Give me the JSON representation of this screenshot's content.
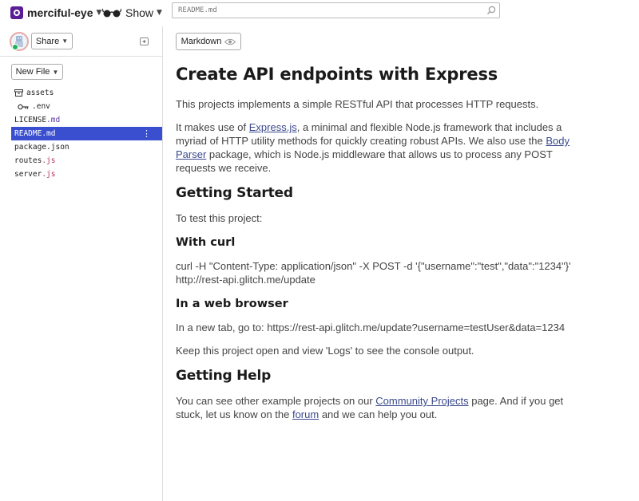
{
  "topbar": {
    "project_name": "merciful-eye",
    "show_label": "Show",
    "search_placeholder": "README.md",
    "icons": [
      "project-logo-icon",
      "chevron-down-icon",
      "glasses-icon",
      "search-icon"
    ]
  },
  "sidebar": {
    "share_label": "Share",
    "new_file_label": "New File",
    "files": [
      {
        "name": "assets",
        "ext": "",
        "icon": "folder-icon",
        "indent": false,
        "active": false
      },
      {
        "name": ".env",
        "ext": "",
        "icon": "key-icon",
        "indent": true,
        "active": false
      },
      {
        "name": "LICENSE",
        "ext": ".md",
        "icon": "",
        "indent": false,
        "active": false
      },
      {
        "name": "README",
        "ext": ".md",
        "icon": "",
        "indent": false,
        "active": true
      },
      {
        "name": "package.json",
        "ext": "",
        "icon": "",
        "indent": false,
        "active": false
      },
      {
        "name": "routes",
        "ext": ".js",
        "icon": "",
        "indent": false,
        "active": false
      },
      {
        "name": "server",
        "ext": ".js",
        "icon": "",
        "indent": false,
        "active": false
      }
    ]
  },
  "main": {
    "markdown_label": "Markdown",
    "doc": {
      "title": "Create API endpoints with Express",
      "intro": "This projects implements a simple RESTful API that processes HTTP requests.",
      "p2_a": "It makes use of ",
      "p2_link1": "Express.js",
      "p2_b": ", a minimal and flexible Node.js framework that includes a myriad of HTTP utility methods for quickly creating robust APIs. We also use the ",
      "p2_link2": "Body Parser",
      "p2_c": " package, which is Node.js middleware that allows us to process any POST requests we receive.",
      "h_getting_started": "Getting Started",
      "p_test": "To test this project:",
      "h_curl": "With curl",
      "p_curl": "curl -H \"Content-Type: application/json\" -X POST -d '{\"username\":\"test\",\"data\":\"1234\"}' http://rest-api.glitch.me/update",
      "h_browser": "In a web browser",
      "p_browser": "In a new tab, go to: https://rest-api.glitch.me/update?username=testUser&data=1234",
      "p_logs": "Keep this project open and view 'Logs' to see the console output.",
      "h_help": "Getting Help",
      "p_help_a": "You can see other example projects on our ",
      "p_help_link1": "Community Projects",
      "p_help_b": " page. And if you get stuck, let us know on the ",
      "p_help_link2": "forum",
      "p_help_c": " and we can help you out."
    }
  }
}
